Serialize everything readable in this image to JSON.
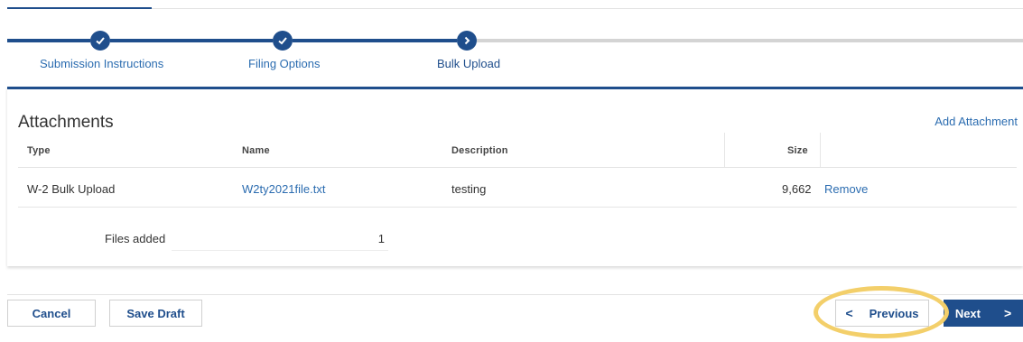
{
  "stepper": {
    "steps": [
      {
        "label": "Submission Instructions",
        "state": "complete"
      },
      {
        "label": "Filing Options",
        "state": "complete"
      },
      {
        "label": "Bulk Upload",
        "state": "current"
      }
    ]
  },
  "attachments": {
    "title": "Attachments",
    "add_link": "Add Attachment",
    "columns": [
      "Type",
      "Name",
      "Description",
      "Size"
    ],
    "rows": [
      {
        "type": "W-2 Bulk Upload",
        "name": "W2ty2021file.txt",
        "description": "testing",
        "size": "9,662",
        "remove_label": "Remove"
      }
    ],
    "files_added_label": "Files added",
    "files_added_value": "1"
  },
  "footer": {
    "cancel_label": "Cancel",
    "save_draft_label": "Save Draft",
    "previous_label": "Previous",
    "next_label": "Next",
    "previous_icon": "<",
    "next_icon": ">"
  },
  "colors": {
    "primary": "#1f4e8c",
    "link": "#2b6cb0",
    "highlight": "#f3cf6a"
  }
}
